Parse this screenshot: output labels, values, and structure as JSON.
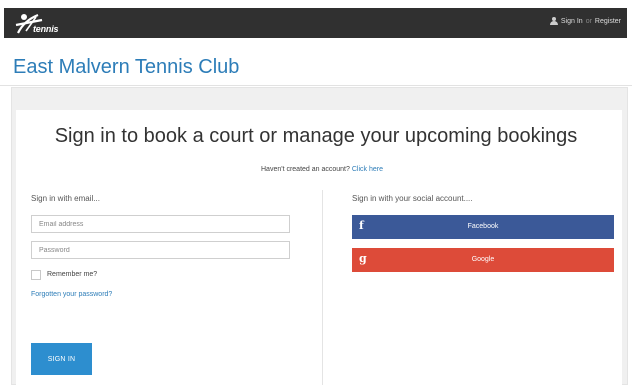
{
  "header": {
    "logo_text": "tennis",
    "signin_label": "Sign In",
    "or_label": "or",
    "register_label": "Register"
  },
  "club": {
    "name": "East Malvern Tennis Club"
  },
  "main": {
    "heading": "Sign in to book a court or manage your upcoming bookings",
    "no_account_text": "Haven't created an account?",
    "click_here": "Click here"
  },
  "email_signin": {
    "label": "Sign in with email...",
    "email_placeholder": "Email address",
    "password_placeholder": "Password",
    "remember_label": "Remember me?",
    "forgot_label": "Forgotten your password?",
    "signin_button": "SIGN IN"
  },
  "social_signin": {
    "label": "Sign in with your social account....",
    "facebook_glyph": "f",
    "facebook_label": "Facebook",
    "google_glyph": "g",
    "google_label": "Google"
  },
  "colors": {
    "topbar": "#303030",
    "link": "#2d7db8",
    "signin_button": "#2d8ecf",
    "facebook": "#3b5998",
    "google": "#dd4b39"
  }
}
